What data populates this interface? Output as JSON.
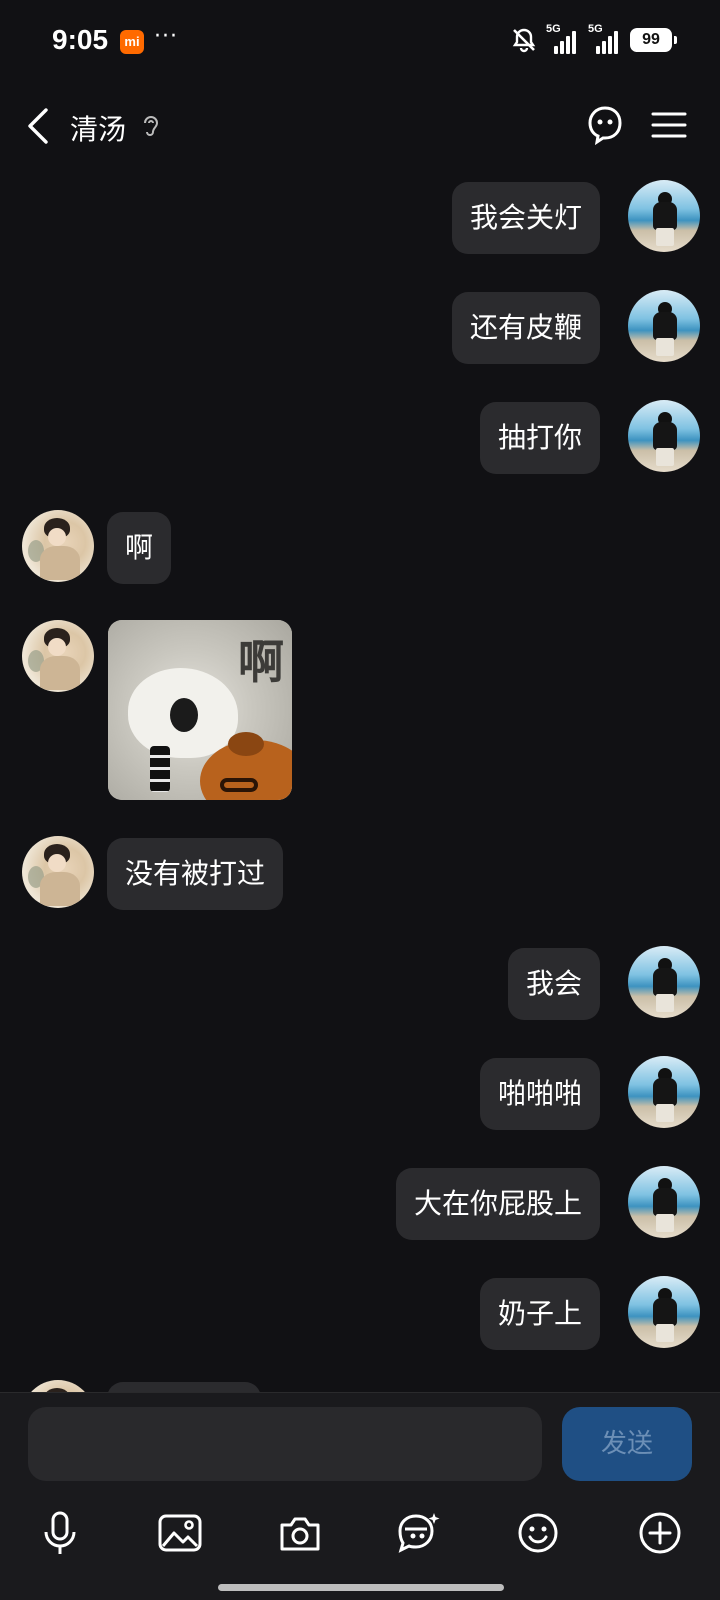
{
  "status_bar": {
    "time": "9:05",
    "app_badge": "mi",
    "more": "···",
    "signal1_label": "5G",
    "signal2_label": "5G",
    "battery": "99"
  },
  "header": {
    "contact_name": "清汤",
    "icons": [
      "back-icon",
      "ear-icon",
      "ghost-icon",
      "menu-icon"
    ]
  },
  "messages": [
    {
      "from": "me",
      "text": "我会关灯"
    },
    {
      "from": "me",
      "text": "还有皮鞭"
    },
    {
      "from": "me",
      "text": "抽打你"
    },
    {
      "from": "them",
      "text": "啊"
    },
    {
      "from": "them",
      "type": "sticker",
      "sticker_text": "啊"
    },
    {
      "from": "them",
      "text": "没有被打过"
    },
    {
      "from": "me",
      "text": "我会"
    },
    {
      "from": "me",
      "text": "啪啪啪"
    },
    {
      "from": "me",
      "text": "大在你屁股上"
    },
    {
      "from": "me",
      "text": "奶子上"
    }
  ],
  "composer": {
    "input_placeholder": "",
    "send_label": "发送",
    "tools": [
      "microphone-icon",
      "image-icon",
      "camera-icon",
      "sticker-icon",
      "emoji-icon",
      "plus-icon"
    ]
  },
  "colors": {
    "background": "#111114",
    "bubble": "#2b2b2e",
    "send_button": "#1f4f84",
    "send_text": "#6c8fb6"
  }
}
